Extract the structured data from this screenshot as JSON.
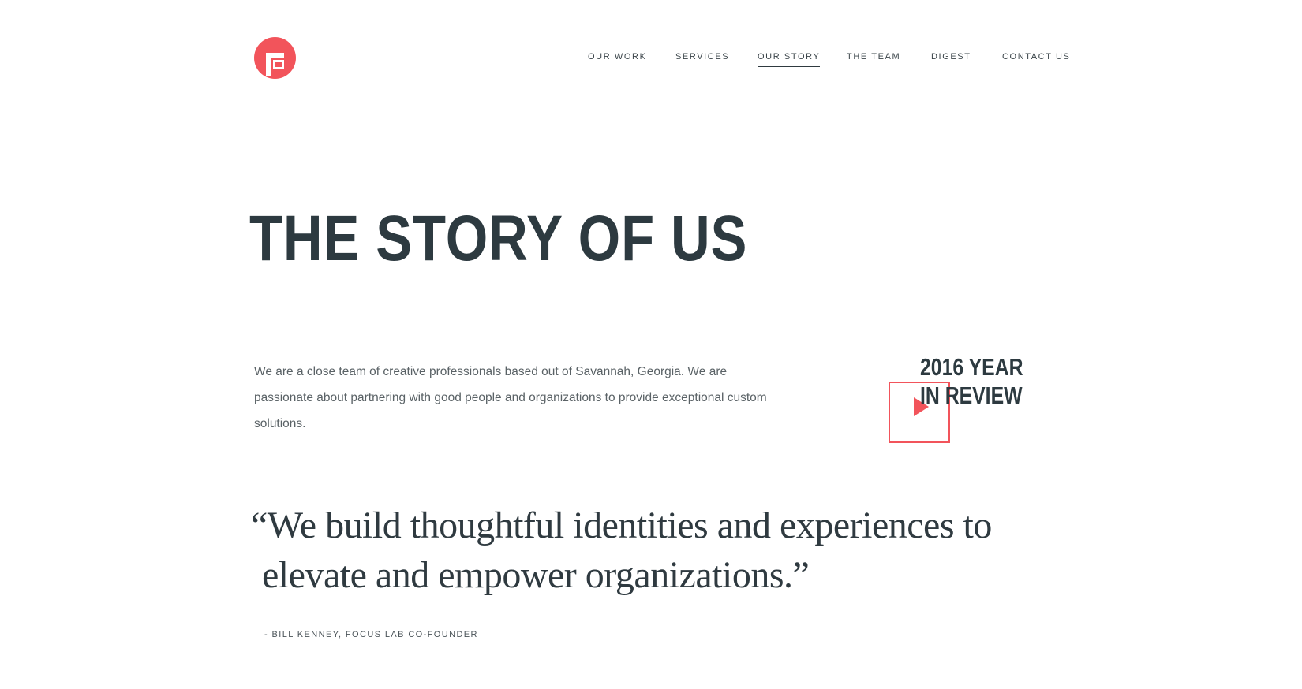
{
  "brand": {
    "logo_icon": "focus-lab-logo-icon",
    "accent_color": "#f2545b",
    "text_color": "#2d3a40"
  },
  "nav": {
    "items": [
      {
        "label": "OUR WORK",
        "active": false
      },
      {
        "label": "SERVICES",
        "active": false
      },
      {
        "label": "OUR STORY",
        "active": true
      },
      {
        "label": "THE TEAM",
        "active": false
      },
      {
        "label": "DIGEST",
        "active": false
      },
      {
        "label": "CONTACT US",
        "active": false
      }
    ]
  },
  "hero": {
    "title": "THE STORY OF US",
    "intro": "We are a close team of creative professionals based out of Savannah, Georgia. We are passionate about partnering with good people and organizations to provide exceptional custom solutions."
  },
  "review": {
    "line1": "2016 YEAR",
    "line2": "IN REVIEW",
    "icon": "play-icon"
  },
  "quote": {
    "line1": "“We build thoughtful identities and experiences to",
    "line2": "elevate and empower organizations.”",
    "attribution": "- BILL KENNEY, FOCUS LAB CO-FOUNDER"
  }
}
